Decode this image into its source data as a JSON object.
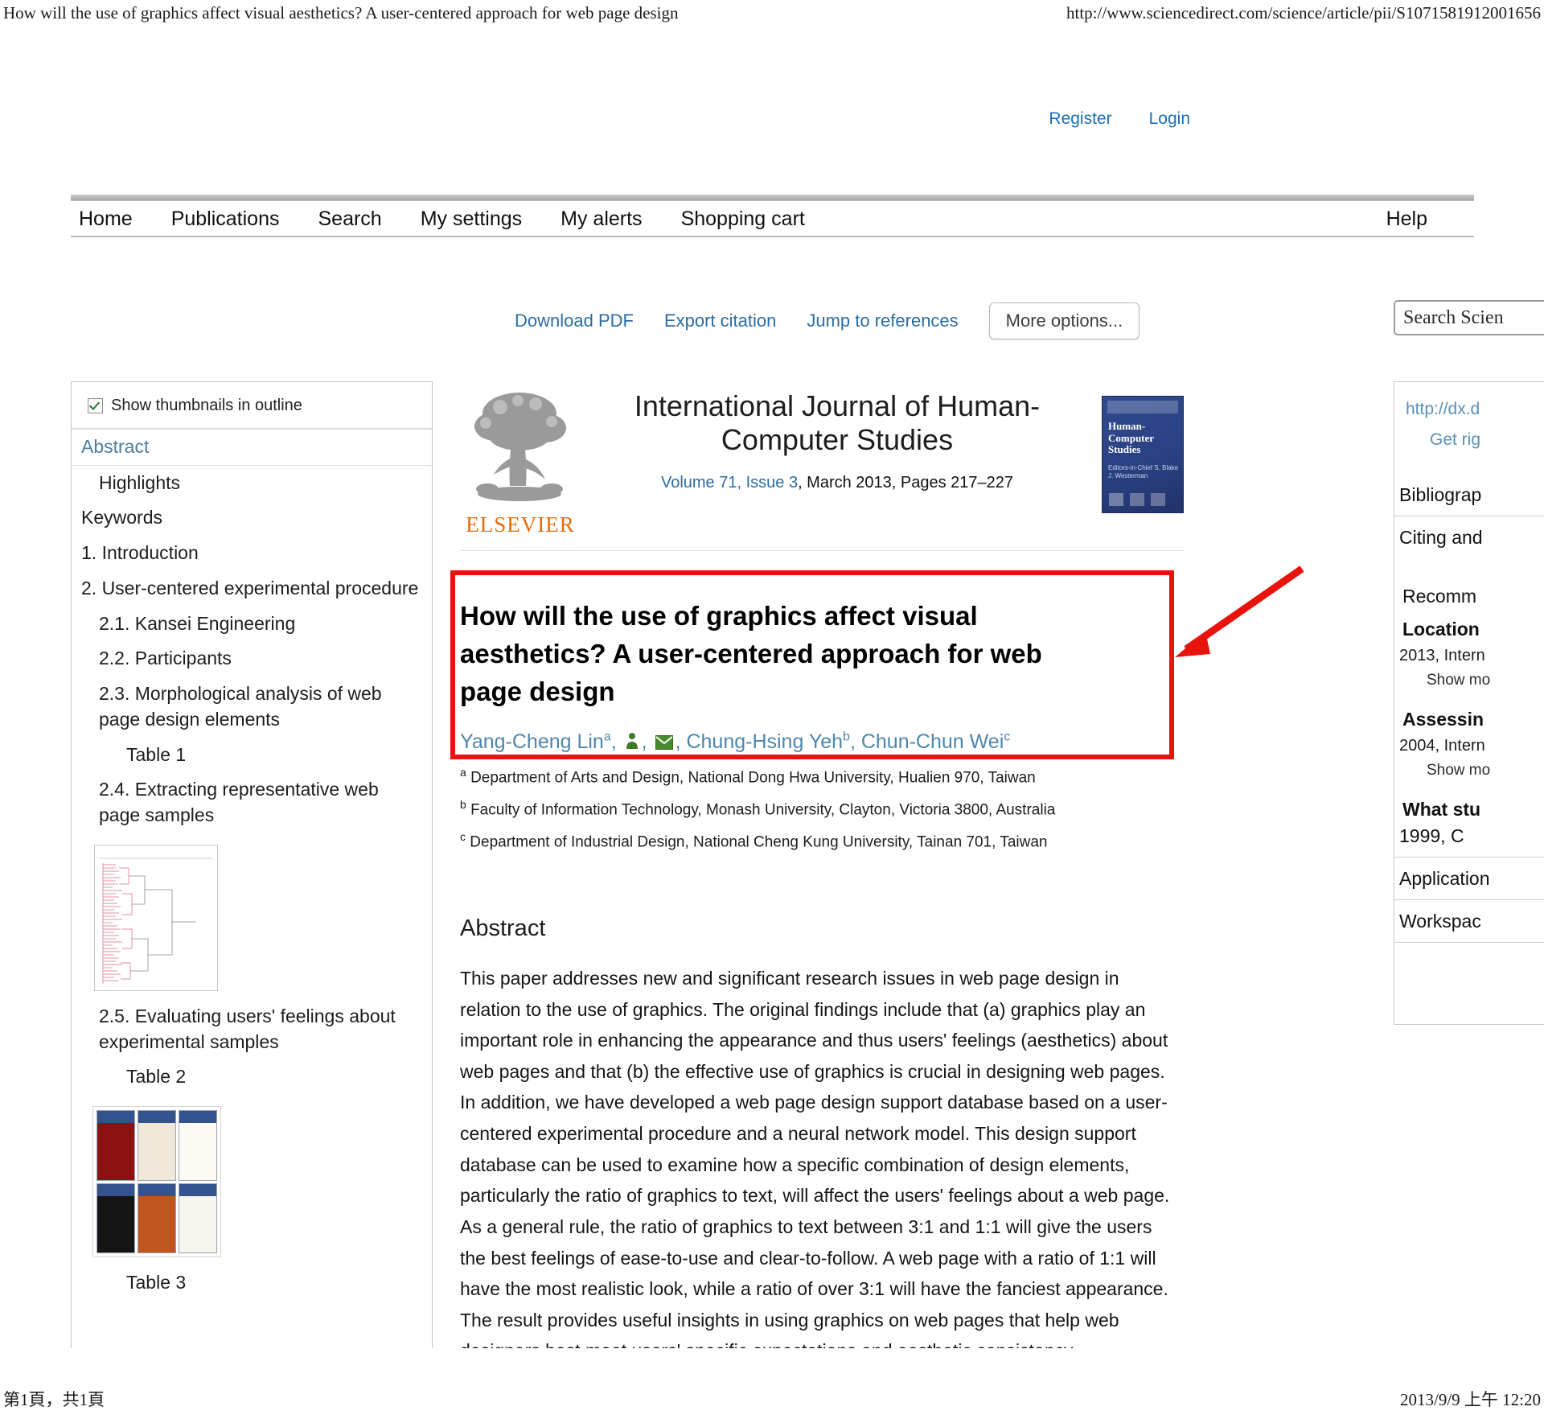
{
  "print_chrome": {
    "header_title": "How will the use of graphics affect visual aesthetics? A user-centered approach for web page design",
    "header_url": "http://www.sciencedirect.com/science/article/pii/S1071581912001656",
    "footer_page": "第1頁，共1頁",
    "footer_date": "2013/9/9 上午 12:20"
  },
  "account_bar": {
    "register": "Register",
    "login": "Login"
  },
  "nav": {
    "items": [
      {
        "label": "Home"
      },
      {
        "label": "Publications"
      },
      {
        "label": "Search"
      },
      {
        "label": "My settings"
      },
      {
        "label": "My alerts"
      },
      {
        "label": "Shopping cart"
      }
    ],
    "help": "Help"
  },
  "actions": {
    "download_pdf": "Download PDF",
    "export_citation": "Export citation",
    "jump_to_references": "Jump to references",
    "more_options": "More options..."
  },
  "search": {
    "value": "Search Scien"
  },
  "outline": {
    "show_thumbnails_label": "Show thumbnails in outline",
    "show_thumbnails_checked": true,
    "items": [
      {
        "label": "Abstract",
        "level": 0,
        "active": true
      },
      {
        "label": "Highlights",
        "level": 1,
        "active": false
      },
      {
        "label": "Keywords",
        "level": 0,
        "active": false
      },
      {
        "label": "1. Introduction",
        "level": 0,
        "active": false
      },
      {
        "label": "2. User-centered experimental procedure",
        "level": 0,
        "active": false
      },
      {
        "label": "2.1. Kansei Engineering",
        "level": 1,
        "active": false
      },
      {
        "label": "2.2. Participants",
        "level": 1,
        "active": false
      },
      {
        "label": "2.3. Morphological analysis of web page design elements",
        "level": 1,
        "active": false
      },
      {
        "label": "Table 1",
        "level": 2,
        "active": false
      },
      {
        "label": "2.4. Extracting representative web page samples",
        "level": 1,
        "active": false
      },
      {
        "label": "2.5. Evaluating users' feelings about experimental samples",
        "level": 1,
        "active": false
      },
      {
        "label": "Table 2",
        "level": 2,
        "active": false
      },
      {
        "label": "Table 3",
        "level": 2,
        "active": false
      }
    ]
  },
  "journal": {
    "publisher": "ELSEVIER",
    "title": "International Journal of Human-Computer Studies",
    "volume_issue": "Volume 71, Issue 3",
    "date_pages": ", March 2013, Pages 217–227",
    "cover_title": "Human-Computer Studies",
    "cover_kicker": "International Journal of",
    "cover_editors": "Editors-in-Chief\nS. Blake\nJ. Westerman"
  },
  "article": {
    "title": "How will the use of graphics affect visual aesthetics? A user-centered approach for web page design",
    "authors_part1": "Yang-Cheng Lin",
    "authors_sup1": "a",
    "authors_part2": ", Chung-Hsing Yeh",
    "authors_sup2": "b",
    "authors_part3": ", Chun-Chun Wei",
    "authors_sup3": "c",
    "affiliations": [
      {
        "marker": "a",
        "text": "Department of Arts and Design, National Dong Hwa University, Hualien 970, Taiwan"
      },
      {
        "marker": "b",
        "text": "Faculty of Information Technology, Monash University, Clayton, Victoria 3800, Australia"
      },
      {
        "marker": "c",
        "text": "Department of Industrial Design, National Cheng Kung University, Tainan 701, Taiwan"
      }
    ],
    "abstract_heading": "Abstract",
    "abstract_text": "This paper addresses new and significant research issues in web page design in relation to the use of graphics. The original findings include that (a) graphics play an important role in enhancing the appearance and thus users' feelings (aesthetics) about web pages and that (b) the effective use of graphics is crucial in designing web pages. In addition, we have developed a web page design support database based on a user-centered experimental procedure and a neural network model. This design support database can be used to examine how a specific combination of design elements, particularly the ratio of graphics to text, will affect the users' feelings about a web page. As a general rule, the ratio of graphics to text between 3:1 and 1:1 will give the users the best feelings of ease-to-use and clear-to-follow. A web page with a ratio of 1:1 will have the most realistic look, while a ratio of over 3:1 will have the fanciest appearance. The result provides useful insights in using graphics on web pages that help web designers best meet users' specific expectations and aesthetic consistency."
  },
  "rail": {
    "doi_link": "http://dx.d",
    "get_rights": "Get rig",
    "bibliography_row": "Bibliograp",
    "citing_row": "Citing and",
    "recommended_heading": "Recomm",
    "rec1_title": "Location",
    "rec1_meta": "2013, Intern",
    "rec1_more": "Show mo",
    "rec2_title": "Assessin",
    "rec2_meta": "2004, Intern",
    "rec2_more": "Show mo",
    "rec3_title": "What stu",
    "rec3_meta": "1999, C",
    "applications_row": "Application",
    "workspace_row": "Workspac"
  },
  "colors": {
    "link_blue": "#2b6ca3",
    "author_blue": "#4e87ad",
    "annotation_red": "#e8130c",
    "elsevier_orange": "#E36C0A"
  }
}
